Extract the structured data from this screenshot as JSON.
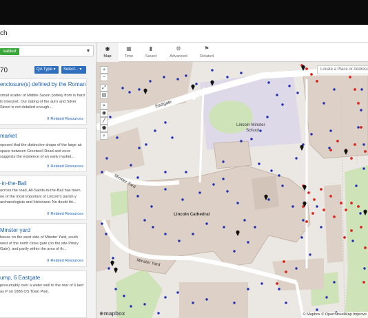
{
  "app": {
    "title": "ch"
  },
  "filter": {
    "status_badge": "nabled",
    "caret": "▾"
  },
  "results": {
    "count": "70",
    "qa_type_label": "QA Type ▾",
    "select_label": "Select... ▾",
    "cards": [
      {
        "title": "enclosure(s) defined by the Roman",
        "desc": "small scatter of Middle Saxon pottery from is hard to interpret. Our dating of the aul's and Silver Street is not detailed enough...",
        "link": "⊽ Related Resources"
      },
      {
        "title": "market",
        "desc": "oposed that the distinctive shape of the large air space between Greetwell Road and ence suggests the existence of an early market...",
        "link": "⊽ Related Resources"
      },
      {
        "title": "-in-the-Bail",
        "desc": "across the road, All-Saints-in-the-Bail has been ne of the most important of Lincoln's parish y archaeologists and historians. No doubt thi...",
        "link": "⊽ Related Resources"
      },
      {
        "title": "Minster yard",
        "desc": "house on the west side of Minster Yard, south west of the north close gate (on the site Priory Gate), and partly within the area of th...",
        "link": "⊽ Related Resources"
      },
      {
        "title": "ump, 6 Eastgate",
        "desc": "presumably over a water well to the rear of 6 ked as P on 1886 OS Town Plan.",
        "link": ""
      }
    ]
  },
  "tabs": [
    {
      "icon": "◉",
      "icon_name": "map-pin-icon",
      "label": "Map",
      "active": true
    },
    {
      "icon": "▦",
      "icon_name": "calendar-icon",
      "label": "Time",
      "active": false
    },
    {
      "icon": "▮",
      "icon_name": "bookmark-icon",
      "label": "Saved",
      "active": false
    },
    {
      "icon": "⚙",
      "icon_name": "gear-icon",
      "label": "Advanced",
      "active": false
    },
    {
      "icon": "⚑",
      "icon_name": "related-icon",
      "label": "Related",
      "active": false
    }
  ],
  "map": {
    "search_placeholder": "Locate a Place or Address",
    "labels": {
      "eastgate": "Eastgate",
      "school_1": "Lincoln Minster",
      "school_2": "School",
      "cathedral": "Lincoln Cathedral",
      "minster_yard_1": "Minster Yard",
      "minster_yard_2": "Minster Yard"
    },
    "attribution": "© Mapbox © OpenStreetMap Improve",
    "logo": "⊕mapbox",
    "tools": [
      {
        "glyph": "+",
        "name": "zoom-in-button"
      },
      {
        "glyph": "−",
        "name": "zoom-out-button"
      },
      {
        "glyph": "⤢",
        "name": "fullscreen-button"
      },
      {
        "glyph": "▤",
        "name": "layers-button"
      },
      {
        "glyph": "⌖",
        "name": "draw-marker-button"
      },
      {
        "glyph": "◉",
        "name": "draw-point-button"
      },
      {
        "glyph": "╱",
        "name": "draw-line-button"
      },
      {
        "glyph": "⬟",
        "name": "draw-polygon-button"
      },
      {
        "glyph": "⌕",
        "name": "search-area-button"
      }
    ],
    "colors": {
      "blue_dot": "#1f2fb3",
      "red_dot": "#d9261c",
      "marker": "#111111",
      "building": "#ddd0c7",
      "green": "#cfe3b8",
      "school": "#ddd9e8"
    }
  }
}
